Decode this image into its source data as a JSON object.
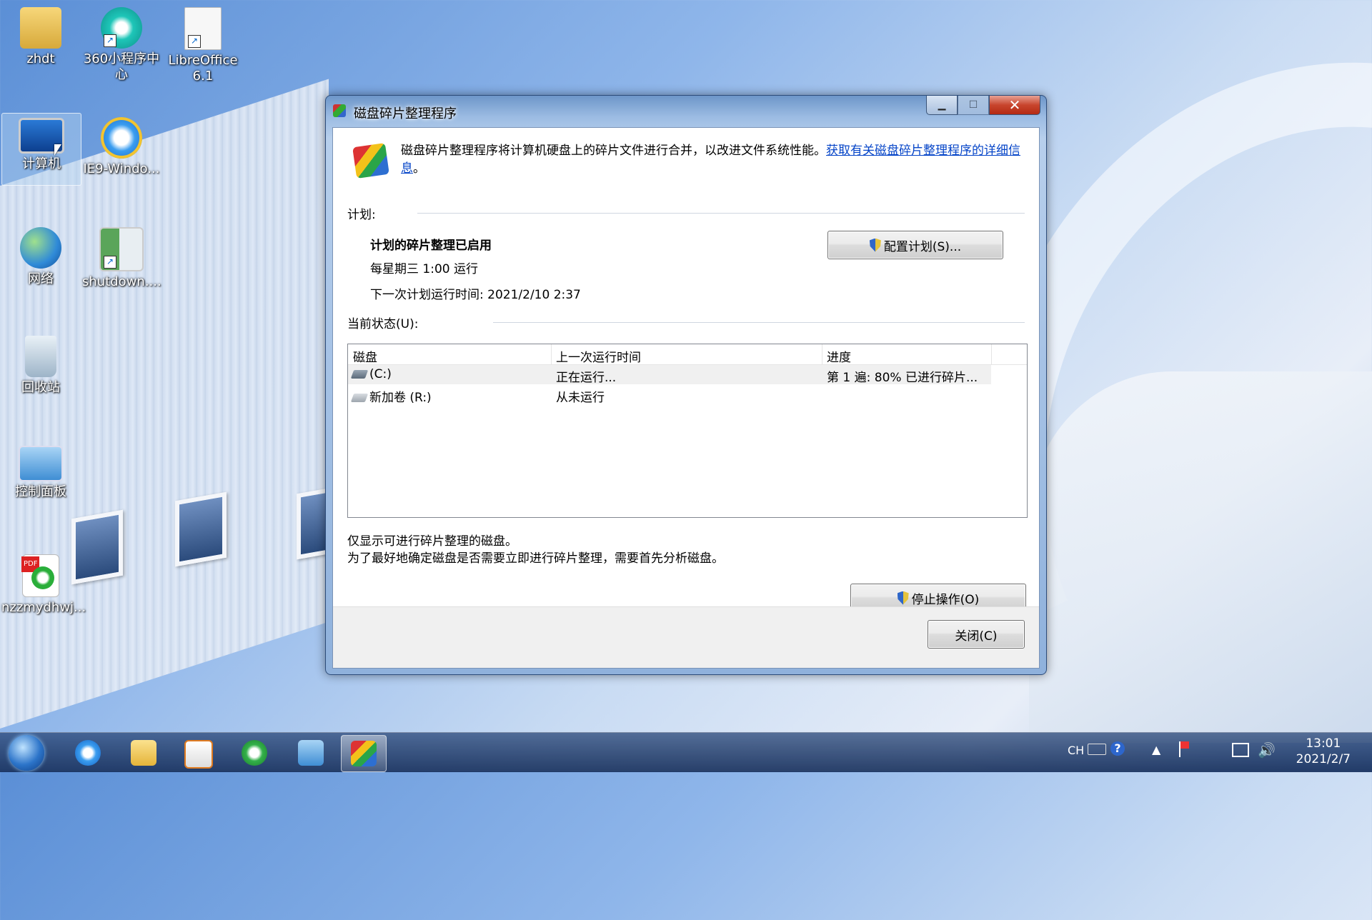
{
  "desktop": {
    "icons": [
      {
        "label": "zhdt"
      },
      {
        "label": "360小程序中心"
      },
      {
        "label": "LibreOffice 6.1"
      },
      {
        "label": "计算机"
      },
      {
        "label": "IE9-Windo..."
      },
      {
        "label": "网络"
      },
      {
        "label": "shutdown...."
      },
      {
        "label": "回收站"
      },
      {
        "label": "控制面板"
      },
      {
        "label": "nzzmydhwj..."
      }
    ]
  },
  "dialog": {
    "title": "磁盘碎片整理程序",
    "description": "磁盘碎片整理程序将计算机硬盘上的碎片文件进行合并，以改进文件系统性能。",
    "link": "获取有关磁盘碎片整理程序的详细信息",
    "description_end": "。",
    "schedule_label": "计划:",
    "schedule_status": "计划的碎片整理已启用",
    "schedule_frequency": "每星期三  1:00 运行",
    "schedule_next": "下一次计划运行时间: 2021/2/10 2:37",
    "configure_button": "配置计划(S)...",
    "current_status_label": "当前状态(U):",
    "table": {
      "columns": [
        "磁盘",
        "上一次运行时间",
        "进度"
      ],
      "rows": [
        {
          "disk": "(C:)",
          "last_run": "正在运行...",
          "progress": "第 1 遍: 80% 已进行碎片..."
        },
        {
          "disk": "新加卷 (R:)",
          "last_run": "从未运行",
          "progress": ""
        }
      ]
    },
    "note1": "仅显示可进行碎片整理的磁盘。",
    "note2": "为了最好地确定磁盘是否需要立即进行碎片整理，需要首先分析磁盘。",
    "stop_button": "停止操作(O)",
    "close_button": "关闭(C)"
  },
  "taskbar": {
    "lang": "CH",
    "time": "13:01",
    "date": "2021/2/7"
  }
}
